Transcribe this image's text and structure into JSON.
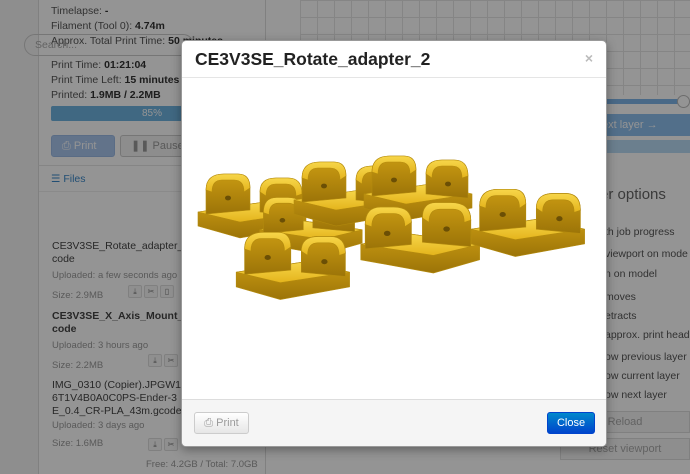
{
  "status": {
    "timelapse_label": "Timelapse:",
    "timelapse_value": "-",
    "filament_label": "Filament (Tool 0):",
    "filament_value": "4.74m",
    "approx_label": "Approx. Total Print Time:",
    "approx_value": "50 minutes",
    "print_time_label": "Print Time:",
    "print_time_value": "01:21:04",
    "time_left_label": "Print Time Left:",
    "time_left_value": "15 minutes",
    "printed_label": "Printed:",
    "printed_value": "1.9MB / 2.2MB",
    "progress_text": "85%",
    "progress_fraction": 0.85,
    "print_button": "Print",
    "pause_button": "Pause"
  },
  "files": {
    "header": "Files",
    "search_placeholder": "Search...",
    "items": [
      {
        "name": "CE3V3SE_Rotate_adapter_",
        "name2": "code",
        "uploaded": "Uploaded: a few seconds ago",
        "size": "Size: 2.9MB"
      },
      {
        "name": "CE3V3SE_X_Axis_Mount_",
        "name2": "code",
        "uploaded": "Uploaded: 3 hours ago",
        "size": "Size: 2.2MB"
      },
      {
        "name": "IMG_0310 (Copier).JPGW1",
        "name2": "6T1V4B0A0C0PS-Ender-3",
        "name3": "E_0.4_CR-PLA_43m.gcode",
        "uploaded": "Uploaded: 3 days ago",
        "size": "Size: 1.6MB"
      }
    ],
    "free_text": "Free: 4.2GB / Total: 7.0GB"
  },
  "viewer": {
    "next_layer": "ext layer →",
    "title": "er options",
    "options": [
      "th job progress",
      "viewport on mode",
      "n on model",
      "moves",
      "etracts",
      "approx. print head",
      "ow previous layer",
      "ow current layer",
      "ow next layer"
    ],
    "reload": "Reload",
    "reset": "Reset viewport"
  },
  "modal": {
    "title": "CE3V3SE_Rotate_adapter_2",
    "close_x": "×",
    "print_button": "Print",
    "close_button": "Close",
    "part_color": "#e8b820"
  }
}
